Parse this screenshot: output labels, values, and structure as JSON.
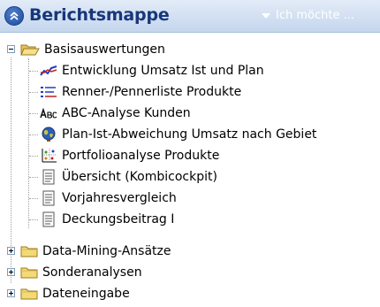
{
  "header": {
    "title": "Berichtsmappe",
    "dropdown_label": "Ich möchte ...",
    "colors": {
      "title": "#17377a",
      "header_bg": "#c5d6ee"
    }
  },
  "tree": {
    "root_folder": {
      "label": "Basisauswertungen",
      "icon": "folder-open-icon",
      "expanded": true
    },
    "children": [
      {
        "label": "Entwicklung Umsatz Ist und Plan",
        "icon": "line-chart-icon"
      },
      {
        "label": "Renner-/Pennerliste Produkte",
        "icon": "ranked-list-icon"
      },
      {
        "label": "ABC-Analyse Kunden",
        "icon": "abc-icon"
      },
      {
        "label": "Plan-Ist-Abweichung Umsatz nach Gebiet",
        "icon": "globe-icon"
      },
      {
        "label": "Portfolioanalyse Produkte",
        "icon": "scatter-chart-icon"
      },
      {
        "label": "Übersicht (Kombicockpit)",
        "icon": "document-icon"
      },
      {
        "label": "Vorjahresvergleich",
        "icon": "document-icon"
      },
      {
        "label": "Deckungsbeitrag I",
        "icon": "document-icon"
      }
    ],
    "folders": [
      {
        "label": "Data-Mining-Ansätze",
        "icon": "folder-icon",
        "expanded": false
      },
      {
        "label": "Sonderanalysen",
        "icon": "folder-icon",
        "expanded": false
      },
      {
        "label": "Dateneingabe",
        "icon": "folder-icon",
        "expanded": false
      }
    ]
  }
}
